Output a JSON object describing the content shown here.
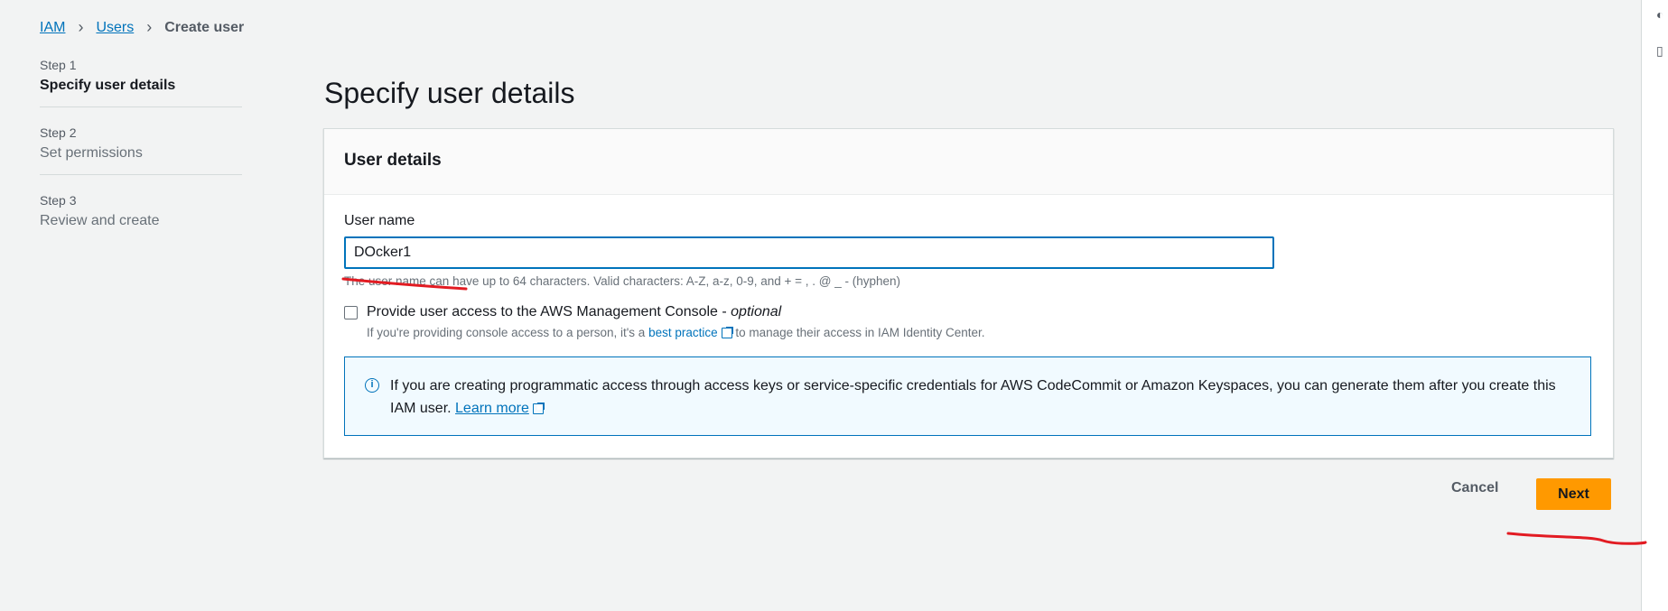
{
  "breadcrumb": {
    "iam": "IAM",
    "users": "Users",
    "current": "Create user"
  },
  "steps": [
    {
      "num": "Step 1",
      "title": "Specify user details"
    },
    {
      "num": "Step 2",
      "title": "Set permissions"
    },
    {
      "num": "Step 3",
      "title": "Review and create"
    }
  ],
  "page": {
    "title": "Specify user details"
  },
  "panel": {
    "header": "User details",
    "user_name_label": "User name",
    "user_name_value": "DOcker1",
    "constraint": "The user name can have up to 64 characters. Valid characters: A-Z, a-z, 0-9, and + = , . @ _ - (hyphen)",
    "console_checkbox_label": "Provide user access to the AWS Management Console - ",
    "console_checkbox_optional": "optional",
    "console_desc_before": "If you're providing console access to a person, it's a ",
    "console_desc_link": "best practice",
    "console_desc_after": " to manage their access in IAM Identity Center.",
    "info_text": "If you are creating programmatic access through access keys or service-specific credentials for AWS CodeCommit or Amazon Keyspaces, you can generate them after you create this IAM user. ",
    "info_link": "Learn more"
  },
  "actions": {
    "cancel": "Cancel",
    "next": "Next"
  },
  "colors": {
    "primary": "#ff9900",
    "link": "#0073bb",
    "annotation": "#e21b22"
  },
  "icons": {
    "info": "info-icon",
    "external": "external-link-icon",
    "breadcrumb_separator": "chevron-right-icon"
  }
}
